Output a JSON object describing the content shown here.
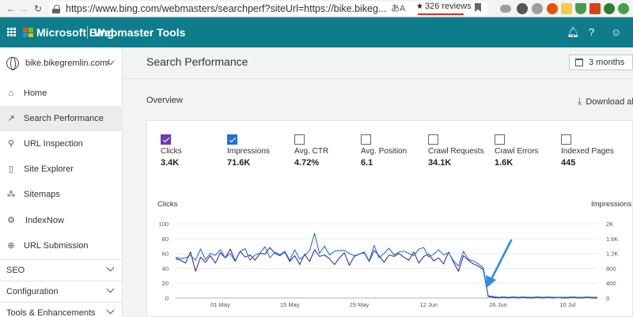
{
  "browser": {
    "url": "https://www.bing.com/webmasters/searchperf?siteUrl=https://bike.bikeg...",
    "reviews": "326 reviews",
    "translate_icon": "translate-icon",
    "extension_colors": [
      "#9e9e9e",
      "#555555",
      "#9e9e9e",
      "#e65100",
      "#f7c948",
      "#43a047",
      "#d84315",
      "#2e7d32",
      "#43a047"
    ]
  },
  "header": {
    "brand": "Microsoft Bing",
    "product": "Webmaster Tools",
    "background": "#0f7c8c"
  },
  "sidebar": {
    "site": "bike.bikegremlin.com/",
    "items": [
      {
        "label": "Home",
        "icon": "home-icon",
        "active": false
      },
      {
        "label": "Search Performance",
        "icon": "trend-icon",
        "active": true
      },
      {
        "label": "URL Inspection",
        "icon": "search-icon",
        "active": false
      },
      {
        "label": "Site Explorer",
        "icon": "document-icon",
        "active": false
      },
      {
        "label": "Sitemaps",
        "icon": "sitemap-icon",
        "active": false
      },
      {
        "label": "IndexNow",
        "icon": "gear-icon",
        "active": false
      },
      {
        "label": "URL Submission",
        "icon": "globe-icon",
        "active": false
      }
    ],
    "groups": [
      {
        "label": "SEO"
      },
      {
        "label": "Configuration"
      },
      {
        "label": "Tools & Enhancements"
      }
    ]
  },
  "main": {
    "title": "Search Performance",
    "date_range": "3 months",
    "overview": "Overview",
    "download": "Download all"
  },
  "metrics": [
    {
      "label": "Clicks",
      "value": "3.4K",
      "checked": true,
      "color": "#6b3ab5"
    },
    {
      "label": "Impressions",
      "value": "71.6K",
      "checked": true,
      "color": "#1a73d9"
    },
    {
      "label": "Avg. CTR",
      "value": "4.72%",
      "checked": false
    },
    {
      "label": "Avg. Position",
      "value": "6.1",
      "checked": false
    },
    {
      "label": "Crawl Requests",
      "value": "34.1K",
      "checked": false
    },
    {
      "label": "Crawl Errors",
      "value": "1.6K",
      "checked": false
    },
    {
      "label": "Indexed Pages",
      "value": "445",
      "checked": false
    }
  ],
  "chart_data": {
    "type": "line",
    "ylabel": "Clicks",
    "y2label": "Impressions",
    "ylim": [
      0,
      100
    ],
    "y2lim": [
      0,
      2000
    ],
    "yticks": [
      "0",
      "20",
      "40",
      "60",
      "80",
      "100"
    ],
    "y2ticks": [
      "0",
      "400",
      "800",
      "1.2K",
      "1.6K",
      "2K"
    ],
    "xticks": [
      "01 May",
      "15 May",
      "29 May",
      "12 Jun",
      "26 Jun",
      "10 Jul"
    ],
    "series": [
      {
        "name": "Clicks",
        "color": "#4a2a9a",
        "values": [
          53,
          51,
          47,
          62,
          36,
          55,
          48,
          57,
          47,
          61,
          54,
          66,
          50,
          63,
          55,
          58,
          51,
          60,
          59,
          68,
          60,
          57,
          62,
          49,
          57,
          45,
          59,
          49,
          65,
          56,
          58,
          53,
          45,
          54,
          61,
          44,
          56,
          59,
          61,
          49,
          64,
          57,
          48,
          58,
          56,
          60,
          55,
          51,
          62,
          47,
          56,
          59,
          50,
          54,
          46,
          62,
          48,
          36,
          57,
          51,
          46,
          43,
          38,
          2,
          1,
          0,
          1,
          0,
          1,
          0,
          1,
          0,
          0,
          1,
          0,
          1,
          0,
          1,
          0,
          0,
          1,
          0,
          0,
          1,
          0,
          0
        ]
      },
      {
        "name": "Impressions",
        "color": "#1f78d1",
        "values": [
          1100,
          1060,
          1080,
          1150,
          1020,
          1320,
          1040,
          1200,
          1150,
          1300,
          1080,
          1200,
          980,
          1250,
          1330,
          1020,
          1160,
          1210,
          1380,
          1080,
          1240,
          1160,
          1260,
          1020,
          1300,
          1040,
          1140,
          1280,
          1740,
          1200,
          1400,
          1160,
          1260,
          1280,
          1280,
          1200,
          1140,
          1180,
          1240,
          1000,
          1420,
          1080,
          1200,
          1340,
          1160,
          1240,
          1260,
          1200,
          1140,
          1320,
          1360,
          1100,
          1180,
          1300,
          1160,
          1220,
          1000,
          860,
          1260,
          1040,
          1000,
          920,
          820,
          60,
          40,
          20,
          30,
          20,
          30,
          20,
          30,
          20,
          20,
          30,
          20,
          30,
          20,
          20,
          20,
          20,
          30,
          20,
          20,
          30,
          20,
          20
        ]
      }
    ],
    "annotation": "arrow pointing to drop"
  }
}
